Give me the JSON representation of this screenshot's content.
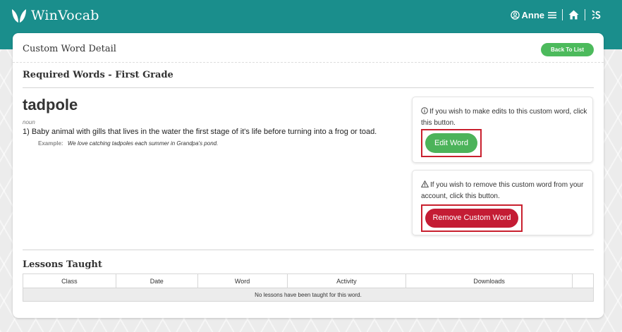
{
  "app": {
    "logo_text": "WinVocab",
    "brand_color": "#1a8e8c",
    "user_name": "Anne",
    "user_icon": "user-circle-icon",
    "menu_icon": "hamburger-menu-icon",
    "home_icon": "home-icon",
    "extra_icon": "s-logo-icon"
  },
  "page": {
    "title": "Custom Word Detail",
    "back_label": "Back To List",
    "section_title": "Required Words - First Grade"
  },
  "word": {
    "term": "tadpole",
    "part_of_speech": "noun",
    "definition": "1) Baby animal with gills that lives in the water the first stage of it's life before turning into a frog or toad.",
    "example_label": "Example:",
    "example_text": "We love catching tadpoles each summer in Grandpa's pond."
  },
  "actions": {
    "edit_info": "If you wish to make edits to this custom word, click this button.",
    "edit_label": "Edit Word",
    "edit_color": "#4cb35a",
    "remove_info": "If you wish to remove this custom word from your account, click this button.",
    "remove_label": "Remove Custom Word",
    "remove_color": "#c41c34",
    "highlight_color": "#c9202e"
  },
  "lessons": {
    "title": "Lessons Taught",
    "columns": [
      "Class",
      "Date",
      "Word",
      "Activity",
      "Downloads",
      ""
    ],
    "empty_message": "No lessons have been taught for this word."
  }
}
